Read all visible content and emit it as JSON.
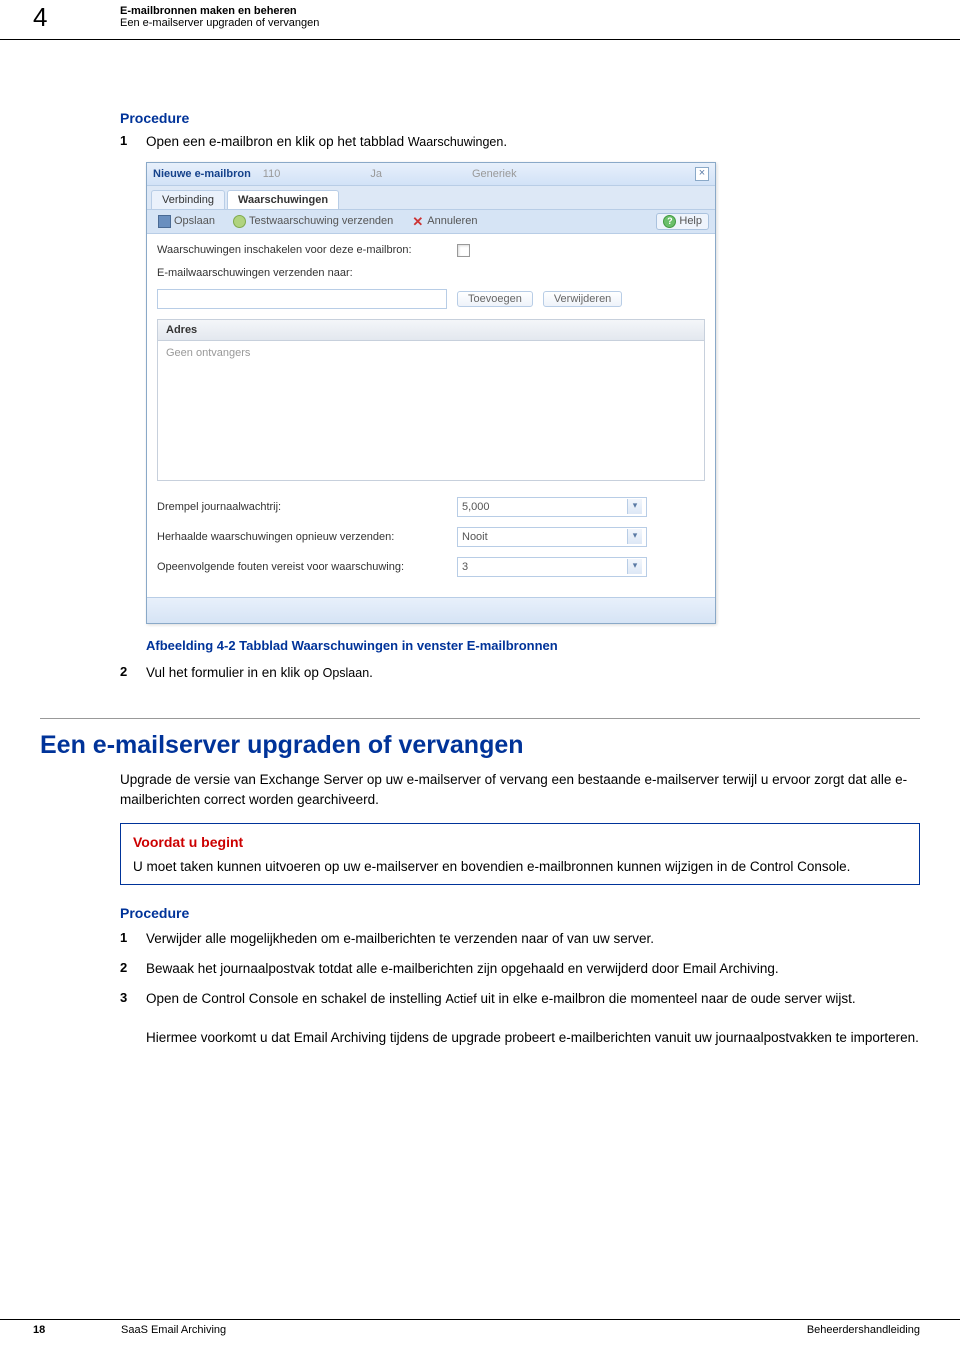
{
  "header": {
    "chapter_number": "4",
    "title_line1": "E-mailbronnen maken en beheren",
    "title_line2": "Een e-mailserver upgraden of vervangen"
  },
  "procedure1": {
    "heading": "Procedure",
    "items": [
      {
        "num": "1",
        "text_pre": "Open een e-mailbron en klik op het tabblad ",
        "term": "Waarschuwingen",
        "text_post": "."
      }
    ]
  },
  "screenshot": {
    "window_title": "Nieuwe e-mailbron",
    "header_ghost_1": "110",
    "header_ghost_2": "Ja",
    "header_ghost_3": "Generiek",
    "tabs": {
      "connection": "Verbinding",
      "warnings": "Waarschuwingen"
    },
    "toolbar": {
      "save": "Opslaan",
      "send_test": "Testwaarschuwing verzenden",
      "cancel": "Annuleren",
      "help": "Help"
    },
    "form": {
      "enable_label": "Waarschuwingen inschakelen voor deze e-mailbron:",
      "sendto_label": "E-mailwaarschuwingen verzenden naar:",
      "add_btn": "Toevoegen",
      "remove_btn": "Verwijderen",
      "panel_head": "Adres",
      "empty_list": "Geen ontvangers",
      "journal_threshold_label": "Drempel journaalwachtrij:",
      "journal_threshold_value": "5,000",
      "resend_label": "Herhaalde waarschuwingen opnieuw verzenden:",
      "resend_value": "Nooit",
      "consecutive_label": "Opeenvolgende fouten vereist voor waarschuwing:",
      "consecutive_value": "3"
    }
  },
  "caption": "Afbeelding 4-2  Tabblad Waarschuwingen in venster E-mailbronnen",
  "procedure1_cont": {
    "items": [
      {
        "num": "2",
        "text_pre": "Vul het formulier in en klik op ",
        "term": "Opslaan",
        "text_post": "."
      }
    ]
  },
  "section": {
    "title": "Een e-mailserver upgraden of vervangen",
    "intro": "Upgrade de versie van Exchange Server op uw e-mailserver of vervang een bestaande e-mailserver terwijl u ervoor zorgt dat alle e-mailberichten correct worden gearchiveerd.",
    "infobox_title": "Voordat u begint",
    "infobox_body": "U moet taken kunnen uitvoeren op uw e-mailserver en bovendien e-mailbronnen kunnen wijzigen in de Control Console.",
    "procedure_heading": "Procedure",
    "steps": [
      {
        "num": "1",
        "text": "Verwijder alle mogelijkheden om e-mailberichten te verzenden naar of van uw server."
      },
      {
        "num": "2",
        "text": "Bewaak het journaalpostvak totdat alle e-mailberichten zijn opgehaald en verwijderd door Email Archiving."
      },
      {
        "num": "3",
        "text_pre": "Open de Control Console en schakel de instelling ",
        "term": "Actief",
        "text_post": " uit in elke e-mailbron die momenteel naar de oude server wijst.",
        "extra": "Hiermee voorkomt u dat Email Archiving tijdens de upgrade probeert e-mailberichten vanuit uw journaalpostvakken te importeren."
      }
    ]
  },
  "footer": {
    "page": "18",
    "left": "SaaS Email Archiving",
    "right": "Beheerdershandleiding"
  }
}
